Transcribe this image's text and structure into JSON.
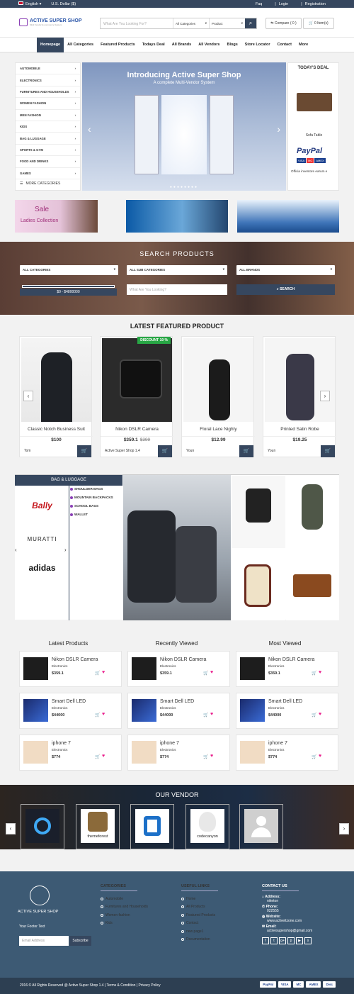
{
  "topbar": {
    "language": "English",
    "currency": "U.S. Dollar ($)",
    "links": [
      "Faq",
      "Login",
      "Registration"
    ]
  },
  "header": {
    "logo_title": "ACTIVE SUPER SHOP",
    "logo_tag": "Multi Vendor E-commerce System",
    "search_placeholder": "What Are You Looking For?",
    "category_select": "All Categories",
    "type_select": "Product",
    "compare_label": "Compare ( 0 )",
    "cart_label": "0 Item(s)"
  },
  "nav": [
    "Homepage",
    "All Categories",
    "Featured Products",
    "Todays Deal",
    "All Brands",
    "All Vendors",
    "Blogs",
    "Store Locator",
    "Contact",
    "More"
  ],
  "categories": [
    "AUTOMOBILE",
    "ELECTRONICS",
    "FURNITURES AND HOUSEHOLDS",
    "WOMEN FASHION",
    "MEN FASHION",
    "KIDS",
    "BAG & LUGGAGE",
    "SPORTS & GYM",
    "FOOD AND DRINKS",
    "GAMES"
  ],
  "more_categories": "MORE CATEGORIES",
  "slider": {
    "title": "Introducing Active Super Shop",
    "subtitle": "A complete Multi-Vendor System"
  },
  "deal": {
    "title": "TODAY'S DEAL",
    "item1": "Sofa Table",
    "item2": "Officia inventore earum e",
    "paypal": "PayPal"
  },
  "banners": {
    "sale": "Sale",
    "ladies": "Ladies Collection"
  },
  "search_section": {
    "title": "SEARCH PRODUCTS",
    "all_categories": "ALL CATEGORIES",
    "all_sub": "ALL SUB CATEGORIES",
    "all_brands": "ALL BRANDS",
    "price": "$0 - $4800000",
    "input_placeholder": "What Are You Looking?",
    "button": "SEARCH"
  },
  "featured": {
    "title": "LATEST FEATURED PRODUCT",
    "discount": "DISCOUNT 10 %",
    "products": [
      {
        "name": "Classic Notch Business Suit",
        "price": "$100",
        "old": "",
        "vendor": "Tom"
      },
      {
        "name": "Nikon DSLR Camera",
        "price": "$359.1",
        "old": "$399",
        "vendor": "Active Super Shop 1.4"
      },
      {
        "name": "Floral Lace Nighty",
        "price": "$12.99",
        "old": "",
        "vendor": "Youn"
      },
      {
        "name": "Printed Satin Robe",
        "price": "$19.25",
        "old": "",
        "vendor": "Youn"
      }
    ]
  },
  "bag": {
    "title": "BAG & LUGGAGE",
    "brands": [
      "Bally",
      "MURATTI",
      "adidas"
    ],
    "subs": [
      "SHOULDER BAGS",
      "MOUNTAIN BACKPACKS",
      "SCHOOL BAGS",
      "WALLET"
    ]
  },
  "lists": [
    {
      "title": "Latest Products",
      "items": [
        {
          "n": "Nikon DSLR Camera",
          "c": "Electronics",
          "p": "$359.1"
        },
        {
          "n": "Smart Dell LED",
          "c": "Electronics",
          "p": "$44000"
        },
        {
          "n": "iphone 7",
          "c": "Electronics",
          "p": "$774"
        }
      ]
    },
    {
      "title": "Recently Viewed",
      "items": [
        {
          "n": "Nikon DSLR Camera",
          "c": "Electronics",
          "p": "$359.1"
        },
        {
          "n": "Smart Dell LED",
          "c": "Electronics",
          "p": "$44000"
        },
        {
          "n": "iphone 7",
          "c": "Electronics",
          "p": "$774"
        }
      ]
    },
    {
      "title": "Most Viewed",
      "items": [
        {
          "n": "Nikon DSLR Camera",
          "c": "Electronics",
          "p": "$359.1"
        },
        {
          "n": "Smart Dell LED",
          "c": "Electronics",
          "p": "$44000"
        },
        {
          "n": "iphone 7",
          "c": "Electronics",
          "p": "$774"
        }
      ]
    }
  ],
  "vendor": {
    "title": "OUR VENDOR",
    "logos": [
      "themeforest",
      "codecanyon"
    ]
  },
  "footer": {
    "logo": "ACTIVE SUPER SHOP",
    "tagline": "Your Footer Text",
    "email_placeholder": "Email Address",
    "subscribe": "Subscribe",
    "categories_title": "CATEGORIES",
    "categories": [
      "Automobile",
      "Furnitures and Households",
      "Women fashion",
      "Kids"
    ],
    "links_title": "USEFUL LINKS",
    "links": [
      "Home",
      "All Products",
      "Featured Products",
      "Contact",
      "new page1",
      "Documentation"
    ],
    "contact_title": "CONTACT US",
    "address_label": "Address:",
    "address": "niketon",
    "phone_label": "Phone:",
    "phone": "022555",
    "website_label": "Website:",
    "website": "www.activeitzone.com",
    "email_label": "Email:",
    "email": "activesupershop@gmail.com"
  },
  "bottom": {
    "copyright": "2016 © All Rights Reserved @ Active Super Shop 1.4 | Terms & Condition | Privacy Policy",
    "payments": [
      "PayPal",
      "VISA",
      "MC",
      "AMEX",
      "Disc"
    ]
  },
  "colors": {
    "primary": "#36475f",
    "footer": "#3d5a74",
    "accent": "#8a3fb5",
    "heart": "#e91e8c"
  }
}
